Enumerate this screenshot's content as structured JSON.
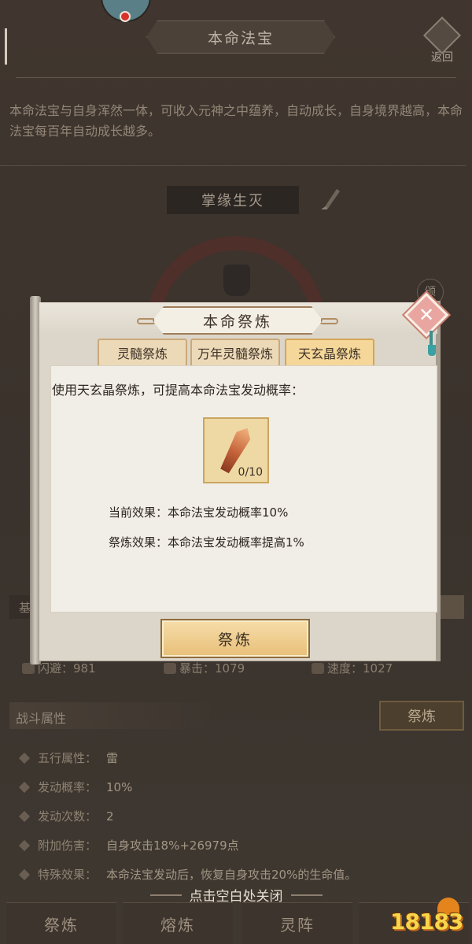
{
  "colors": {
    "modal_bg": "#dcd6ca",
    "tab_active": "#f5d79a",
    "button_gold": "#e8bf78",
    "close_pink": "#e9a6a0"
  },
  "header": {
    "title": "本命法宝",
    "back_label": "返回"
  },
  "intro": {
    "description": "本命法宝与自身浑然一体，可收入元神之中蕴养，自动成长，自身境界越高，本命法宝每百年自动成长越多。"
  },
  "treasure": {
    "name": "掌缘生灭",
    "side_badge": "颁"
  },
  "base_section": {
    "label": "基"
  },
  "stats": {
    "dodge": "闪避：981",
    "crit": "暴击：1079",
    "speed": "速度：1027"
  },
  "combat": {
    "section_title": "战斗属性",
    "refine_label": "祭炼",
    "attributes": [
      {
        "key": "五行属性：",
        "value": "雷"
      },
      {
        "key": "发动概率：",
        "value": "10%"
      },
      {
        "key": "发动次数：",
        "value": "2"
      },
      {
        "key": "附加伤害：",
        "value": "自身攻击18%+26979点"
      },
      {
        "key": "特殊效果：",
        "value": "本命法宝发动后，恢复自身攻击20%的生命值。"
      }
    ]
  },
  "close_hint": "点击空白处关闭",
  "bottom_tabs": [
    "祭炼",
    "熔炼",
    "灵阵",
    ""
  ],
  "watermark": "18183",
  "modal": {
    "title": "本命祭炼",
    "tabs": [
      {
        "label": "灵髓祭炼",
        "active": false
      },
      {
        "label": "万年灵髓祭炼",
        "active": false
      },
      {
        "label": "天玄晶祭炼",
        "active": true
      }
    ],
    "description": "使用天玄晶祭炼，可提高本命法宝发动概率：",
    "item": {
      "icon": "crystal-icon",
      "count": "0/10"
    },
    "current_effect": "当前效果：本命法宝发动概率10%",
    "refine_effect": "祭炼效果：本命法宝发动概率提高1%",
    "action_label": "祭炼",
    "close_icon": "close-icon"
  }
}
